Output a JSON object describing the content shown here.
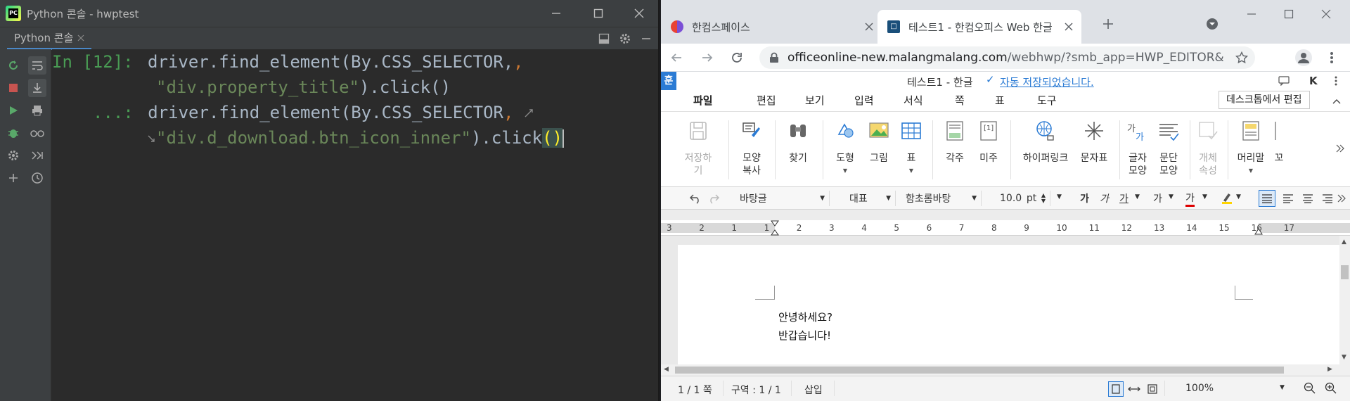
{
  "pycharm": {
    "window_title": "Python 콘솔 - hwptest",
    "tab_label": "Python 콘솔",
    "line1_prompt": "In [12]:",
    "line1_code": "driver.find_element(By.CSS_SELECTOR,",
    "line1_comma": ",",
    "line2_str": "\"div.property_title\"",
    "line2_rest": ").click()",
    "line3_prompt": "...:",
    "line3_code": "driver.find_element(By.CSS_SELECTOR",
    "line3_comma": ",",
    "line4_str": "\"div.d_download.btn_icon_inner\"",
    "line4_mid": ").click",
    "line4_paren": "()"
  },
  "browser": {
    "tab1_label": "한컴스페이스",
    "tab2_label": "테스트1 - 한컴오피스 Web 한글",
    "url_host": "officeonline-new.malangmalang.com",
    "url_path": "/webhwp/?smb_app=HWP_EDITOR&docId=c..."
  },
  "hwp": {
    "app_badge": "훈",
    "doc_title": "테스트1 - 한글",
    "autosave": "자동 저장되었습니다.",
    "user_initial": "K",
    "menus": [
      "파일",
      "편집",
      "보기",
      "입력",
      "서식",
      "쪽",
      "표",
      "도구"
    ],
    "desktop_edit": "데스크톱에서 편집",
    "ribbon": {
      "save": "저장하기",
      "format_copy_1": "모양",
      "format_copy_2": "복사",
      "find": "찾기",
      "shape": "도형",
      "picture": "그림",
      "table": "표",
      "footnote": "각주",
      "endnote": "미주",
      "hyperlink": "하이퍼링크",
      "charmap": "문자표",
      "char_shape_1": "글자",
      "char_shape_2": "모양",
      "para_shape_1": "문단",
      "para_shape_2": "모양",
      "obj_prop_1": "개체",
      "obj_prop_2": "속성",
      "header": "머리말",
      "more": "꼬"
    },
    "format": {
      "style": "바탕글",
      "lang": "대표",
      "font": "함초롬바탕",
      "size": "10.0",
      "unit": "pt",
      "bold_glyph": "가",
      "italic_glyph": "가",
      "underline_glyph": "가",
      "strike_glyph": "가",
      "color_glyph": "가"
    },
    "ruler_ticks": [
      "3",
      "2",
      "1",
      "1",
      "2",
      "3",
      "4",
      "5",
      "6",
      "7",
      "8",
      "9",
      "10",
      "11",
      "12",
      "13",
      "14",
      "15",
      "16",
      "17"
    ],
    "doc_lines": [
      "안녕하세요?",
      "반갑습니다!"
    ],
    "status": {
      "page": "1 / 1 쪽",
      "section": "구역 : 1 / 1",
      "mode": "삽입",
      "zoom": "100%"
    }
  },
  "colors": {
    "ide_bg": "#2b2b2b",
    "ide_panel": "#3c3f41",
    "ide_string": "#6a8759",
    "ide_keyword": "#cc7832",
    "ide_prompt": "#499c54",
    "hwp_accent": "#2b7bd4"
  }
}
